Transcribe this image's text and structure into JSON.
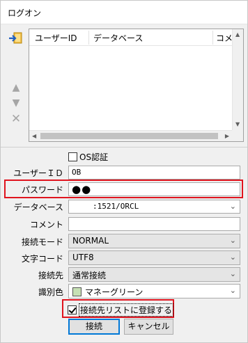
{
  "window": {
    "title": "ログオン"
  },
  "list": {
    "columns": [
      "ユーザーID",
      "データベース",
      "コメ"
    ]
  },
  "side_buttons": {
    "up": "▲",
    "down": "▼",
    "delete": "✕"
  },
  "os_auth": {
    "label": "OS認証",
    "checked": false
  },
  "form": {
    "user_id": {
      "label": "ユーザーＩＤ",
      "value": "OB"
    },
    "password": {
      "label": "パスワード",
      "value": "●●"
    },
    "database": {
      "label": "データベース",
      "value": ":1521/ORCL"
    },
    "comment": {
      "label": "コメント",
      "value": ""
    },
    "connect_mode": {
      "label": "接続モード",
      "value": "NORMAL"
    },
    "charset": {
      "label": "文字コード",
      "value": "UTF8"
    },
    "connection": {
      "label": "接続先",
      "value": "通常接続"
    },
    "color": {
      "label": "識別色",
      "value": "マネーグリーン",
      "swatch": "#c6e0b4"
    }
  },
  "register": {
    "label": "接続先リストに登録する",
    "checked": true
  },
  "buttons": {
    "connect": "接続",
    "cancel": "キャンセル"
  },
  "highlight_color": "#e0141e"
}
